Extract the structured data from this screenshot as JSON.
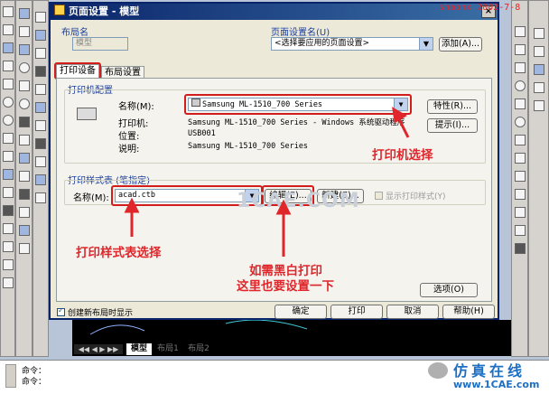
{
  "watermark_top": "shaonx 2002-7-8",
  "watermark_center": "1CAE.COM",
  "brand": {
    "cn": "仿真在线",
    "url": "www.1CAE.com"
  },
  "dialog": {
    "title": "页面设置 - 模型",
    "close_glyph": "×",
    "layout_name_label": "布局名",
    "layout_name_value": "模型",
    "page_setup_name_label": "页面设置名(U)",
    "page_setup_select_value": "<选择要应用的页面设置>",
    "add_button": "添加(A)...",
    "tabs": [
      "打印设备",
      "布局设置"
    ],
    "printer_config_title": "打印机配置",
    "printer_name_label": "名称(M):",
    "printer_name_value": "Samsung ML-1510_700 Series",
    "properties_button": "特性(R)...",
    "hints_button": "提示(I)...",
    "printer_label": "打印机:",
    "printer_value": "Samsung ML-1510_700 Series - Windows 系统驱动程序",
    "location_label": "位置:",
    "location_value": "USB001",
    "description_label": "说明:",
    "description_value": "Samsung ML-1510_700 Series",
    "style_table_title": "打印样式表 (笔指定)",
    "style_name_label": "名称(M):",
    "style_name_value": "acad.ctb",
    "edit_button": "编辑(E)...",
    "new_button": "新建(E)...",
    "display_styles_label": "显示打印样式(Y)",
    "options_button": "选项(O)",
    "create_viewport_label": "创建新布局时显示",
    "ok_button": "确定",
    "print_button": "打印",
    "cancel_button": "取消",
    "help_button": "帮助(H)"
  },
  "annotations": {
    "printer_select": "打印机选择",
    "style_select": "打印样式表选择",
    "bw_line1": "如需黑白打印",
    "bw_line2": "这里也要设置一下"
  },
  "layout_tabs": [
    "模型",
    "布局1",
    "布局2"
  ],
  "command_lines": [
    "命令：",
    "命令："
  ]
}
